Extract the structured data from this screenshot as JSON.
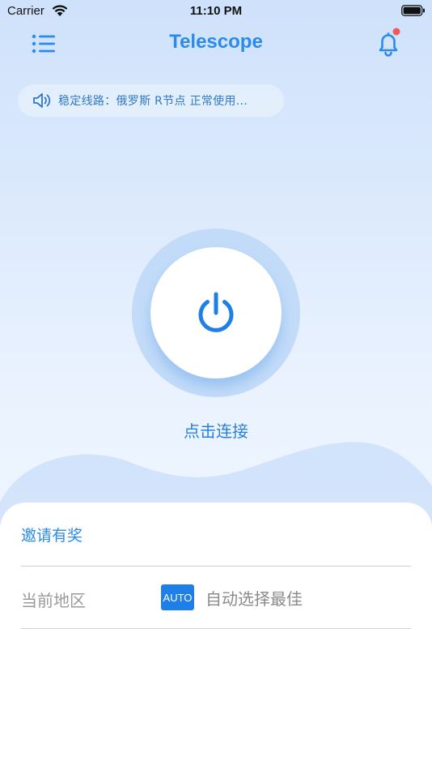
{
  "status_bar": {
    "carrier": "Carrier",
    "time": "11:10 PM"
  },
  "header": {
    "title": "Telescope",
    "has_unread_notification": true
  },
  "notice": {
    "text": "稳定线路：俄罗斯 R节点 正常使用..."
  },
  "connect": {
    "label": "点击连接"
  },
  "menu": {
    "invite_label": "邀请有奖",
    "region_label": "当前地区",
    "region_badge": "AUTO",
    "region_value": "自动选择最佳"
  },
  "colors": {
    "accent": "#2a8bea",
    "badge": "#1e7fe8",
    "notification_dot": "#f05a5a"
  },
  "icons": {
    "menu": "list-menu-icon",
    "bell": "bell-icon",
    "speaker": "speaker-icon",
    "power": "power-icon"
  }
}
